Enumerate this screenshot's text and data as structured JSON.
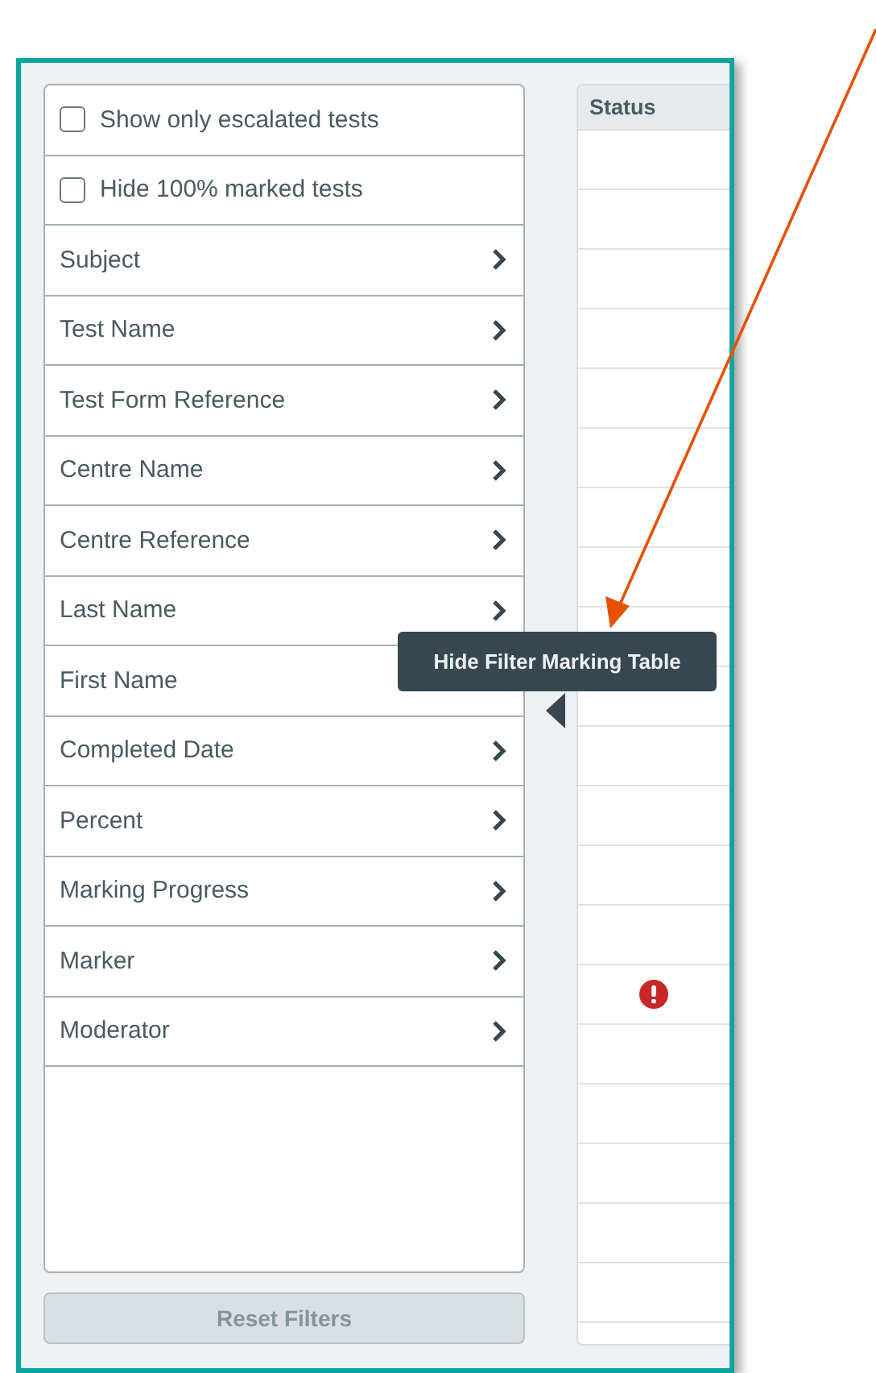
{
  "filters": [
    {
      "kind": "checkbox",
      "label": "Show only escalated tests",
      "checked": false
    },
    {
      "kind": "checkbox",
      "label": "Hide 100% marked tests",
      "checked": false
    },
    {
      "kind": "expander",
      "label": "Subject"
    },
    {
      "kind": "expander",
      "label": "Test Name"
    },
    {
      "kind": "expander",
      "label": "Test Form Reference"
    },
    {
      "kind": "expander",
      "label": "Centre Name"
    },
    {
      "kind": "expander",
      "label": "Centre Reference"
    },
    {
      "kind": "expander",
      "label": "Last Name"
    },
    {
      "kind": "expander",
      "label": "First Name"
    },
    {
      "kind": "expander",
      "label": "Completed Date"
    },
    {
      "kind": "expander",
      "label": "Percent"
    },
    {
      "kind": "expander",
      "label": "Marking Progress"
    },
    {
      "kind": "expander",
      "label": "Marker"
    },
    {
      "kind": "expander",
      "label": "Moderator"
    }
  ],
  "reset_button": "Reset Filters",
  "table": {
    "columns": [
      "Status"
    ],
    "rows": [
      {
        "escalated": false
      },
      {
        "escalated": false
      },
      {
        "escalated": false
      },
      {
        "escalated": false
      },
      {
        "escalated": false
      },
      {
        "escalated": false
      },
      {
        "escalated": false
      },
      {
        "escalated": false
      },
      {
        "escalated": false
      },
      {
        "escalated": false
      },
      {
        "escalated": false
      },
      {
        "escalated": false
      },
      {
        "escalated": false
      },
      {
        "escalated": false
      },
      {
        "escalated": true
      },
      {
        "escalated": false
      },
      {
        "escalated": false
      },
      {
        "escalated": false
      },
      {
        "escalated": false
      },
      {
        "escalated": false
      }
    ]
  },
  "tooltip": "Hide Filter Marking Table"
}
